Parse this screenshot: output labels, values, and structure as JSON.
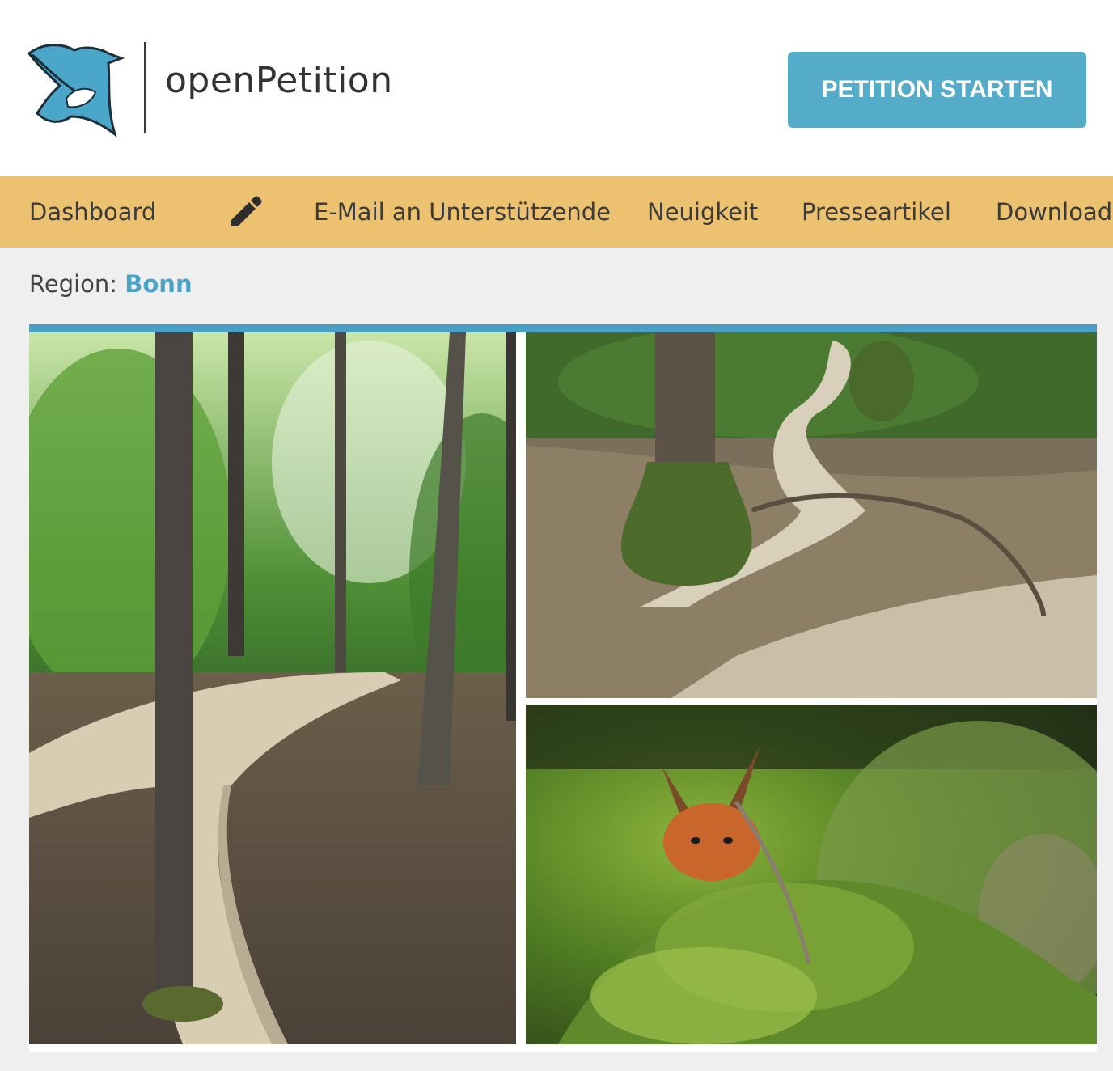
{
  "header": {
    "logo_text": "openPetition",
    "cta_label": "PETITION STARTEN"
  },
  "nav": {
    "items": [
      {
        "label": "Dashboard"
      },
      {
        "label": "E-Mail an Unterstützende"
      },
      {
        "label": "Neuigkeit"
      },
      {
        "label": "Presseartikel"
      },
      {
        "label": "Download"
      }
    ],
    "edit_icon": "pencil-icon"
  },
  "region": {
    "prefix": "Region:",
    "value": "Bonn"
  },
  "colors": {
    "brand": "#55acc9",
    "nav_bg": "#ecc270",
    "page_bg": "#efefef",
    "gallery_border": "#4a9fc4"
  }
}
